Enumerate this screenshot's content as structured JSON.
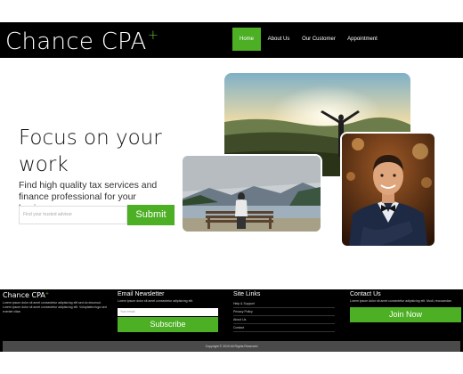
{
  "header": {
    "logo_text": "Chance CPA",
    "logo_plus": "+",
    "nav": [
      {
        "label": "Home",
        "active": true
      },
      {
        "label": "About Us",
        "active": false
      },
      {
        "label": "Our Customer",
        "active": false
      },
      {
        "label": "Appointment",
        "active": false
      }
    ]
  },
  "hero": {
    "title": "Focus on your work",
    "subtitle": "Find high quality tax services and finance professional for your business",
    "input_placeholder": "Find your trusted advisor",
    "button_label": "Submit"
  },
  "footer": {
    "about": {
      "logo_text": "Chance CPA",
      "logo_plus": "+",
      "text": "Lorem ipsum dolor sit amet consectetur adipisicing elit sed do eiusmod. Lorem ipsum dolor sit amet consectetur adipisicing elit. Voluptates fuga sed eveniet vitae."
    },
    "newsletter": {
      "title": "Email Newsletter",
      "text": "Lorem ipsum dolor sit amet consectetur adipisicing elit.",
      "input_placeholder": "Your email",
      "button_label": "Subscribe"
    },
    "links": {
      "title": "Site Links",
      "items": [
        "Help & Support",
        "Privacy Policy",
        "About Us",
        "Contact"
      ]
    },
    "contact": {
      "title": "Contact Us",
      "text": "Lorem ipsum dolor sit amet consectetur adipisicing elit. Modi, recusandae.",
      "button_label": "Join Now"
    },
    "copyright": "Copyright © 2019 All Rights Reserved"
  },
  "colors": {
    "accent": "#4caf24",
    "nav_bg": "#000000",
    "footer_bg": "#000000",
    "copyright_bg": "#4a4a4a"
  },
  "images": {
    "sunset": "person with raised arms facing sunset over hills",
    "bench": "person sitting on bench facing lake and mountains",
    "portrait": "smiling man in suit and bow tie"
  }
}
